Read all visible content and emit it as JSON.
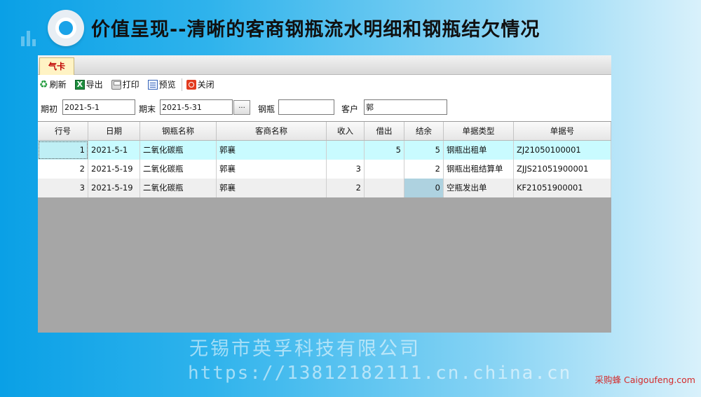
{
  "slide": {
    "title": "价值呈现--清晰的客商钢瓶流水明细和钢瓶结欠情况"
  },
  "app": {
    "tab": "气卡",
    "toolbar": {
      "refresh": "刷新",
      "export": "导出",
      "print": "打印",
      "preview": "预览",
      "close": "关闭"
    },
    "filter": {
      "start_label": "期初",
      "start_value": "2021-5-1",
      "end_label": "期末",
      "end_value": "2021-5-31",
      "browse_label": "...",
      "bottle_label": "钢瓶",
      "bottle_value": "",
      "customer_label": "客户",
      "customer_value": "郭"
    },
    "grid": {
      "columns": [
        "行号",
        "日期",
        "钢瓶名称",
        "客商名称",
        "收入",
        "借出",
        "结余",
        "单据类型",
        "单据号"
      ],
      "rows": [
        {
          "no": "1",
          "date": "2021-5-1",
          "bottle": "二氧化碳瓶",
          "customer": "郭襄",
          "in": "",
          "out": "5",
          "balance": "5",
          "type": "钢瓶出租单",
          "doc": "ZJ21050100001"
        },
        {
          "no": "2",
          "date": "2021-5-19",
          "bottle": "二氧化碳瓶",
          "customer": "郭襄",
          "in": "3",
          "out": "",
          "balance": "2",
          "type": "钢瓶出租结算单",
          "doc": "ZJJS21051900001"
        },
        {
          "no": "3",
          "date": "2021-5-19",
          "bottle": "二氧化碳瓶",
          "customer": "郭襄",
          "in": "2",
          "out": "",
          "balance": "0",
          "type": "空瓶发出单",
          "doc": "KF21051900001"
        }
      ]
    }
  },
  "watermark": {
    "company": "无锡市英孚科技有限公司",
    "url": "https://13812182111.cn.china.cn"
  },
  "corner_mark": "采购蜂 Caigoufeng.com",
  "colors": {
    "tab_text": "#c00000",
    "selected_row": "#c9fbff",
    "selected_cell": "#aed2e0",
    "empty_grid": "#a6a6a6"
  }
}
